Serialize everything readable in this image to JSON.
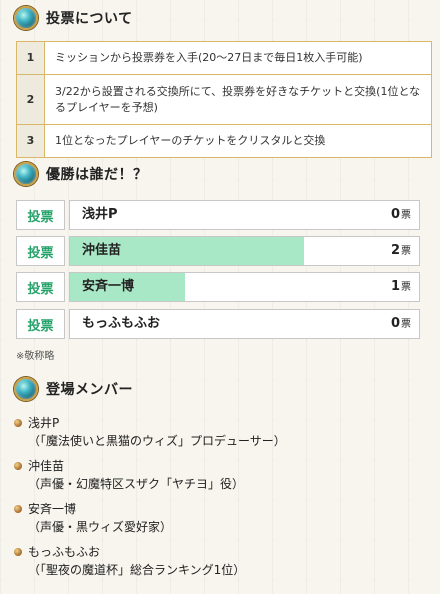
{
  "section_about": {
    "title": "投票について"
  },
  "rules": [
    {
      "num": "1",
      "text": "ミッションから投票券を入手(20〜27日まで毎日1枚入手可能)"
    },
    {
      "num": "2",
      "text": "3/22から設置される交換所にて、投票券を好きなチケットと交換(1位となるプレイヤーを予想)"
    },
    {
      "num": "3",
      "text": "1位となったプレイヤーのチケットをクリスタルと交換"
    }
  ],
  "section_winner": {
    "title": "優勝は誰だ！？"
  },
  "votes": [
    {
      "button": "投票",
      "name": "浅井P",
      "count": "0",
      "unit": "票",
      "share": 0
    },
    {
      "button": "投票",
      "name": "沖佳苗",
      "count": "2",
      "unit": "票",
      "share": 0.67
    },
    {
      "button": "投票",
      "name": "安斉一博",
      "count": "1",
      "unit": "票",
      "share": 0.33
    },
    {
      "button": "投票",
      "name": "もっふもふお",
      "count": "0",
      "unit": "票",
      "share": 0
    }
  ],
  "note": "※敬称略",
  "section_members": {
    "title": "登場メンバー"
  },
  "members": [
    {
      "name": "浅井P",
      "desc": "（「魔法使いと黒猫のウィズ」プロデューサー）"
    },
    {
      "name": "沖佳苗",
      "desc": "（声優・幻魔特区スザク「ヤチヨ」役）"
    },
    {
      "name": "安斉一博",
      "desc": "（声優・黒ウィズ愛好家）"
    },
    {
      "name": "もっふもふお",
      "desc": "（「聖夜の魔道杯」総合ランキング1位）"
    }
  ],
  "colors": {
    "accent_green": "#26a36a",
    "bar_fill": "#a9e8c6",
    "border_gold": "#d8b868"
  }
}
